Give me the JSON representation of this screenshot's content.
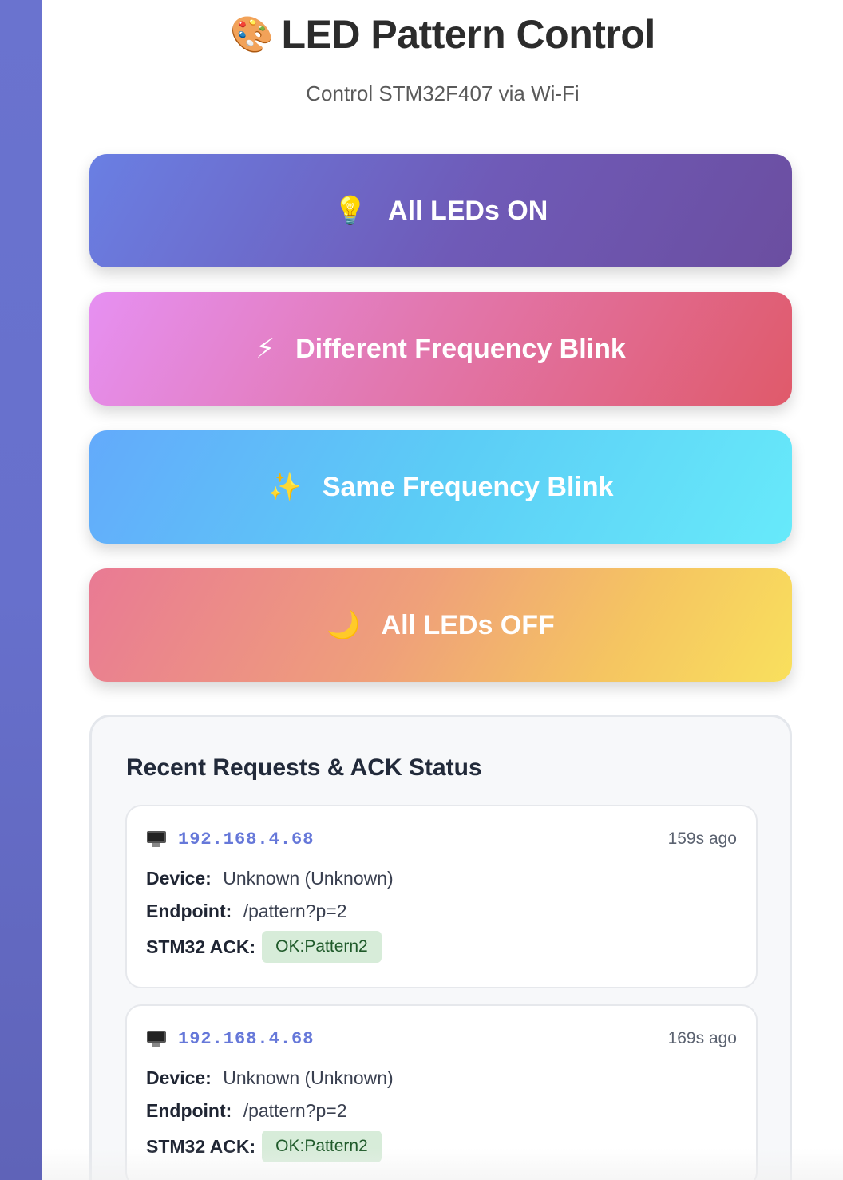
{
  "header": {
    "title_icon": "🎨",
    "title": "LED Pattern Control",
    "subtitle": "Control STM32F407 via Wi-Fi"
  },
  "patterns": [
    {
      "icon": "💡",
      "label": "All LEDs ON",
      "colors": [
        "#6a7fe3",
        "#6b4ea0"
      ]
    },
    {
      "icon": "⚡",
      "label": "Different Frequency Blink",
      "colors": [
        "#e690f2",
        "#e05a6a"
      ]
    },
    {
      "icon": "✨",
      "label": "Same Frequency Blink",
      "colors": [
        "#63aafb",
        "#67eafa"
      ]
    },
    {
      "icon": "🌙",
      "label": "All LEDs OFF",
      "colors": [
        "#e97a94",
        "#f9e05d"
      ]
    }
  ],
  "requests": {
    "title": "Recent Requests & ACK Status",
    "labels": {
      "device": "Device:",
      "endpoint": "Endpoint:",
      "ack": "STM32 ACK:"
    },
    "items": [
      {
        "icon": "desktop-monitor-icon",
        "ip": "192.168.4.68",
        "ago": "159s ago",
        "device": "Unknown (Unknown)",
        "endpoint": "/pattern?p=2",
        "ack": "OK:Pattern2"
      },
      {
        "icon": "desktop-monitor-icon",
        "ip": "192.168.4.68",
        "ago": "169s ago",
        "device": "Unknown (Unknown)",
        "endpoint": "/pattern?p=2",
        "ack": "OK:Pattern2"
      }
    ]
  },
  "colors": {
    "ip_accent": "#6678d9",
    "ack_bg": "#d7ecd9",
    "ack_text": "#1f5a2a"
  }
}
